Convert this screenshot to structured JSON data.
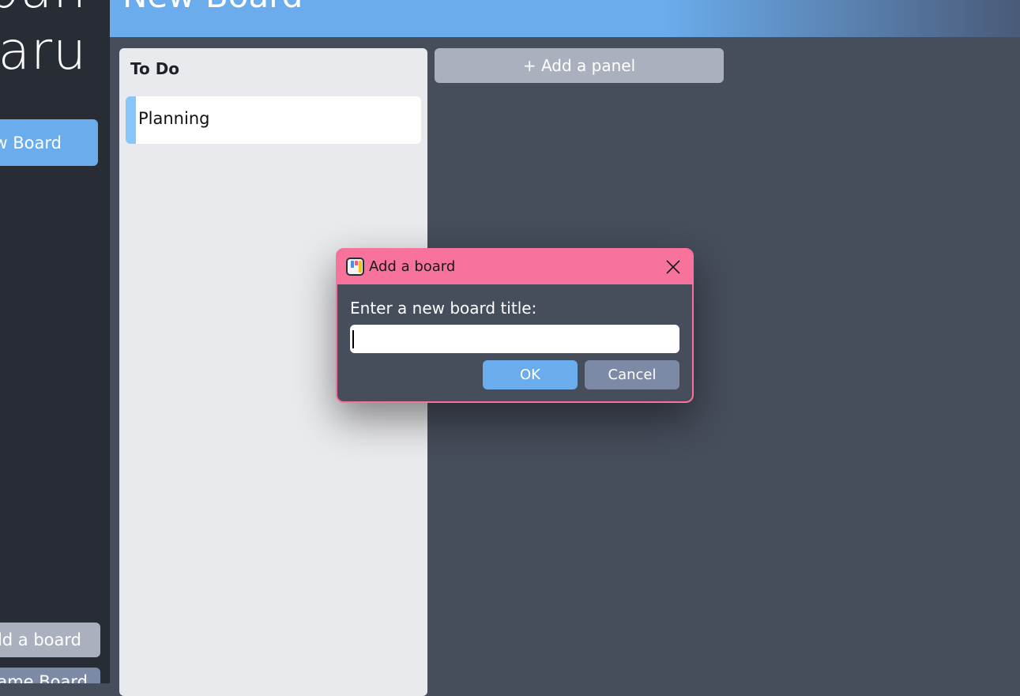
{
  "sidebar": {
    "app_title": "Kanban\nKaru",
    "new_board_label": "New Board",
    "add_board_label": "Add a board",
    "rename_board_label": "Rename Board"
  },
  "header": {
    "board_title": "New Board"
  },
  "board": {
    "panels": [
      {
        "title": "To Do",
        "cards": [
          {
            "text": "Planning",
            "accent_color": "#86c6fb"
          }
        ]
      }
    ],
    "add_panel_label": "+ Add a panel"
  },
  "dialog": {
    "title": "Add a board",
    "icon": "kanban-app-icon",
    "close_icon": "close-icon",
    "prompt": "Enter a new board title:",
    "input_value": "",
    "input_placeholder": "",
    "ok_label": "OK",
    "cancel_label": "Cancel"
  },
  "colors": {
    "accent_blue": "#6aacec",
    "dialog_pink": "#f7739b",
    "sidebar_bg": "#282c35",
    "main_bg": "#464d5b",
    "panel_bg": "#e9eaed",
    "secondary_button": "#7d8aa5",
    "muted_button": "#aab0bd"
  }
}
